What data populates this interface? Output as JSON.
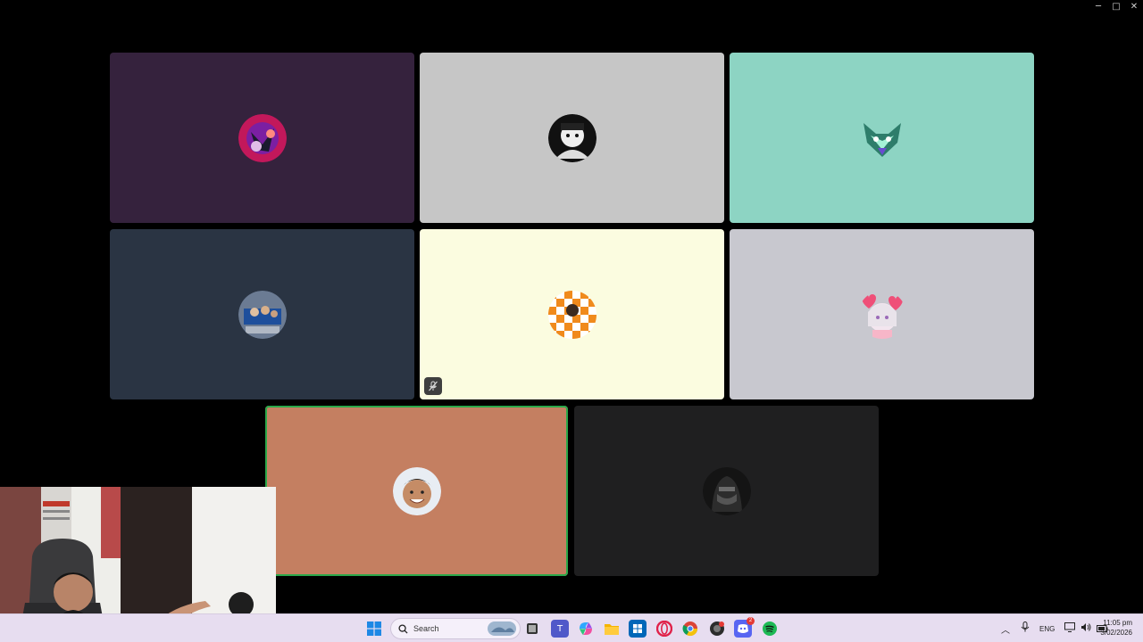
{
  "window": {
    "minimize_label": "─",
    "maximize_label": "□",
    "close_label": "✕"
  },
  "tiles": [
    {
      "bg": "#35223d",
      "avatar": "red-purple-art-avatar",
      "speaking": false,
      "muted": false
    },
    {
      "bg": "#c6c6c6",
      "avatar": "black-white-portrait-avatar",
      "speaking": false,
      "muted": false
    },
    {
      "bg": "#8dd4c3",
      "avatar": "green-fox-avatar",
      "speaking": false,
      "muted": false
    },
    {
      "bg": "#2a3443",
      "avatar": "blue-group-photo-avatar",
      "speaking": false,
      "muted": false
    },
    {
      "bg": "#fbfce0",
      "avatar": "orange-checkered-avatar",
      "speaking": false,
      "muted": true
    },
    {
      "bg": "#c8c8cf",
      "avatar": "anime-hearts-avatar",
      "speaking": false,
      "muted": false
    },
    {
      "bg": "#c47f61",
      "avatar": "smiling-man-avatar",
      "speaking": true,
      "muted": false
    },
    {
      "bg": "#1f1f20",
      "avatar": "dark-hooded-avatar",
      "speaking": false,
      "muted": false
    }
  ],
  "taskbar": {
    "search_placeholder": "Search",
    "language": "ENG",
    "time": "11:05 pm",
    "date": "3/02/2026",
    "discord_badge": "2"
  },
  "colors": {
    "taskbar_bg": "#e7ddf0",
    "speaking_outline": "#2aa84a",
    "windows_blue": "#1e88e5"
  }
}
